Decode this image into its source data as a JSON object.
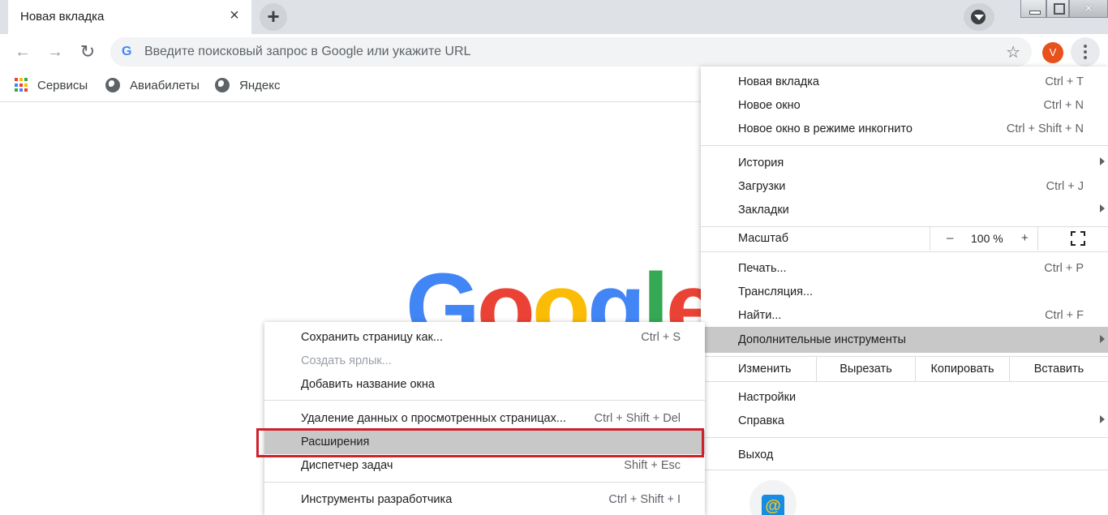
{
  "tab": {
    "title": "Новая вкладка"
  },
  "omnibox": {
    "placeholder": "Введите поисковый запрос в Google или укажите URL"
  },
  "avatar": {
    "letter": "V",
    "color": "#e8501c"
  },
  "bookmarks": [
    {
      "label": "Сервисы",
      "icon": "apps-grid-icon"
    },
    {
      "label": "Авиабилеты",
      "icon": "globe-icon"
    },
    {
      "label": "Яндекс",
      "icon": "globe-icon"
    }
  ],
  "google_logo": {
    "letters": [
      "G",
      "o",
      "o",
      "g",
      "l",
      "e"
    ],
    "colors": [
      "#4285f4",
      "#ea4335",
      "#fbbc05",
      "#4285f4",
      "#34a853",
      "#ea4335"
    ]
  },
  "main_menu": {
    "items": [
      {
        "label": "Новая вкладка",
        "shortcut": "Ctrl + T"
      },
      {
        "label": "Новое окно",
        "shortcut": "Ctrl + N"
      },
      {
        "label": "Новое окно в режиме инкогнито",
        "shortcut": "Ctrl + Shift + N"
      },
      {
        "label": "История",
        "shortcut": ""
      },
      {
        "label": "Загрузки",
        "shortcut": "Ctrl + J"
      },
      {
        "label": "Закладки",
        "shortcut": ""
      },
      {
        "label": "Печать...",
        "shortcut": "Ctrl + P"
      },
      {
        "label": "Трансляция...",
        "shortcut": ""
      },
      {
        "label": "Найти...",
        "shortcut": "Ctrl + F"
      },
      {
        "label": "Дополнительные инструменты",
        "shortcut": ""
      },
      {
        "label": "Настройки",
        "shortcut": ""
      },
      {
        "label": "Справка",
        "shortcut": ""
      },
      {
        "label": "Выход",
        "shortcut": ""
      }
    ],
    "zoom": {
      "label": "Масштаб",
      "minus": "–",
      "value": "100 %",
      "plus": "+"
    },
    "edit": {
      "label": "Изменить",
      "cut": "Вырезать",
      "copy": "Копировать",
      "paste": "Вставить"
    }
  },
  "sub_menu": {
    "items": [
      {
        "label": "Сохранить страницу как...",
        "shortcut": "Ctrl + S"
      },
      {
        "label": "Создать ярлык...",
        "shortcut": ""
      },
      {
        "label": "Добавить название окна",
        "shortcut": ""
      },
      {
        "label": "Удаление данных о просмотренных страницах...",
        "shortcut": "Ctrl + Shift + Del"
      },
      {
        "label": "Расширения",
        "shortcut": ""
      },
      {
        "label": "Диспетчер задач",
        "shortcut": "Shift + Esc"
      },
      {
        "label": "Инструменты разработчика",
        "shortcut": "Ctrl + Shift + I"
      }
    ]
  },
  "highlight_color": "#d0202a"
}
